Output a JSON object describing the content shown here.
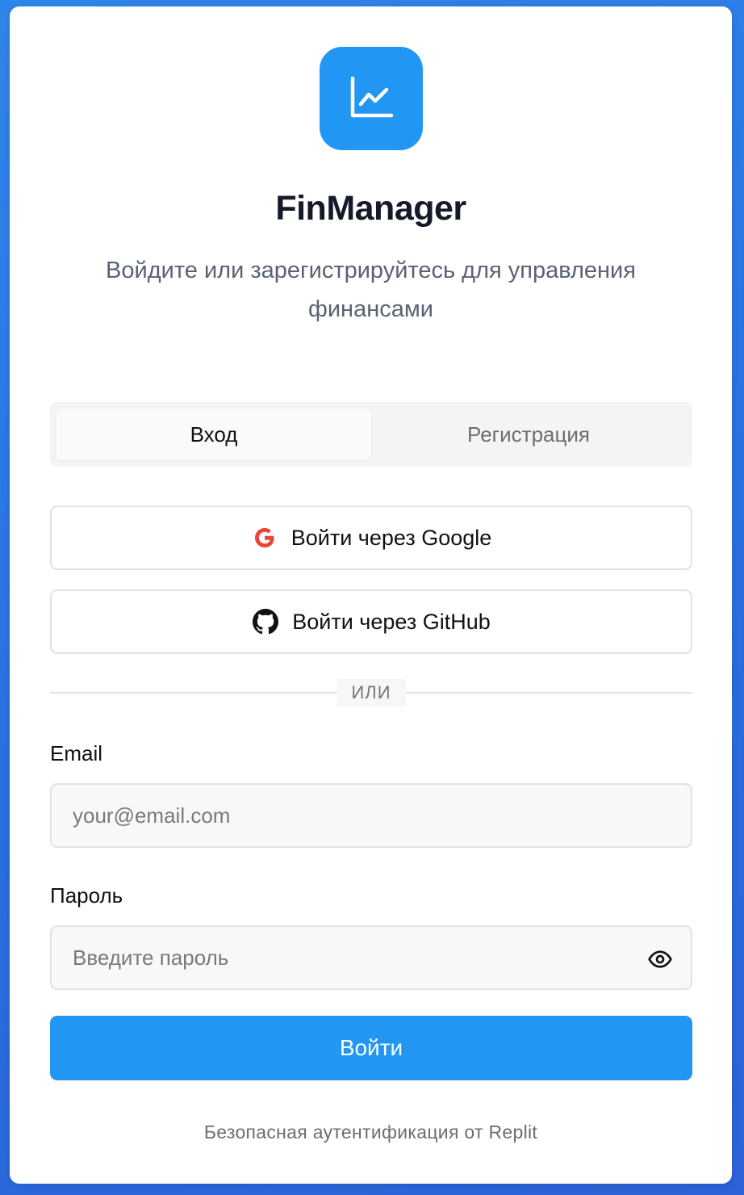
{
  "app": {
    "title": "FinManager",
    "subtitle": "Войдите или зарегистрируйтесь для управления финансами",
    "logo_icon": "line-chart-icon",
    "accent_color": "#2196f3"
  },
  "tabs": [
    {
      "label": "Вход",
      "active": true
    },
    {
      "label": "Регистрация",
      "active": false
    }
  ],
  "oauth": {
    "google": {
      "label": "Войти через Google",
      "icon": "google-icon"
    },
    "github": {
      "label": "Войти через GitHub",
      "icon": "github-icon"
    }
  },
  "divider_text": "ИЛИ",
  "form": {
    "email": {
      "label": "Email",
      "placeholder": "your@email.com",
      "value": ""
    },
    "password": {
      "label": "Пароль",
      "placeholder": "Введите пароль",
      "value": "",
      "toggle_icon": "eye-icon"
    },
    "submit_label": "Войти"
  },
  "footer": "Безопасная аутентификация от Replit"
}
